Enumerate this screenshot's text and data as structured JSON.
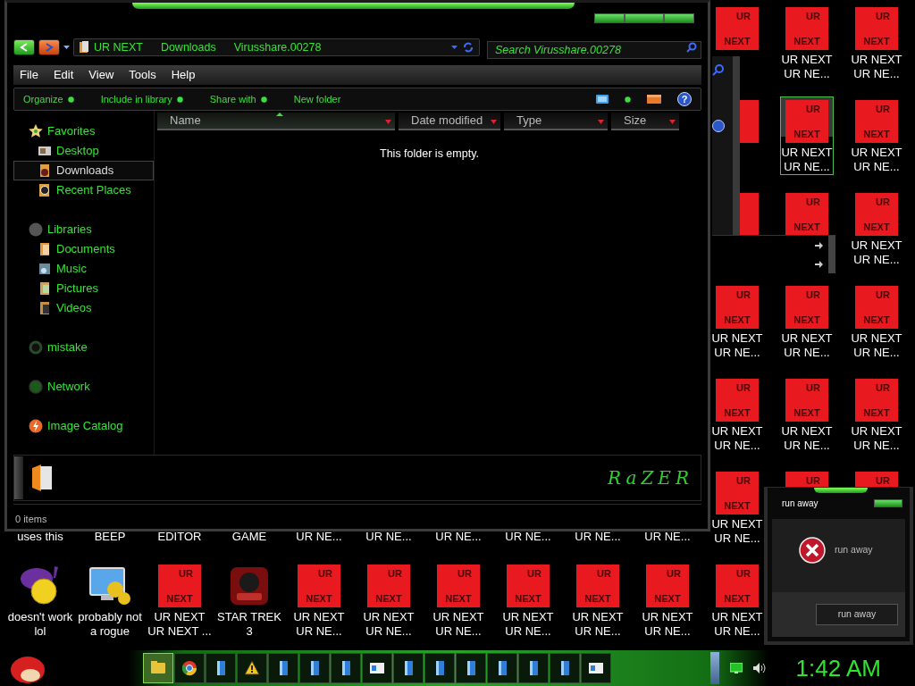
{
  "explorer": {
    "breadcrumb": [
      "UR NEXT",
      "Downloads",
      "Virusshare.00278"
    ],
    "search": {
      "placeholder": "Search Virusshare.00278"
    },
    "menu": [
      "File",
      "Edit",
      "View",
      "Tools",
      "Help"
    ],
    "commands": [
      {
        "label": "Organize",
        "dropdown": true
      },
      {
        "label": "Include in library",
        "dropdown": true
      },
      {
        "label": "Share with",
        "dropdown": true
      },
      {
        "label": "New folder",
        "dropdown": false
      }
    ],
    "help_glyph": "?",
    "sidebar": [
      {
        "label": "Favorites",
        "selected": false,
        "children": [
          {
            "label": "Desktop",
            "selected": false
          },
          {
            "label": "Downloads",
            "selected": true
          },
          {
            "label": "Recent Places",
            "selected": false
          }
        ]
      },
      {
        "label": "Libraries",
        "selected": false,
        "children": [
          {
            "label": "Documents",
            "selected": false
          },
          {
            "label": "Music",
            "selected": false
          },
          {
            "label": "Pictures",
            "selected": false
          },
          {
            "label": "Videos",
            "selected": false
          }
        ]
      },
      {
        "label": "mistake",
        "selected": false
      },
      {
        "label": "Network",
        "selected": false
      },
      {
        "label": "Image Catalog",
        "selected": false
      }
    ],
    "columns": [
      {
        "label": "Name",
        "sorted": true
      },
      {
        "label": "Date modified",
        "sorted": false
      },
      {
        "label": "Type",
        "sorted": false
      },
      {
        "label": "Size",
        "sorted": false
      }
    ],
    "empty_message": "This folder is empty.",
    "logo": "RaZER",
    "status": "0 items"
  },
  "desktop": {
    "right_block": [
      [
        {
          "kind": "app",
          "art_text": [
            "UR",
            "NEXT"
          ],
          "selected": false
        },
        {
          "kind": "app",
          "art_text": [
            "UR",
            "NEXT"
          ],
          "label": "UR NEXT\nUR NE...",
          "selected": false
        },
        {
          "kind": "app",
          "art_text": [
            "UR",
            "NEXT"
          ],
          "label": "UR NEXT\nUR NE...",
          "selected": false
        }
      ],
      [
        {
          "kind": "app",
          "selected": false
        },
        {
          "kind": "app",
          "art_text": [
            "UR",
            "NEXT"
          ],
          "label": "UR NEXT\nUR NE...",
          "selected": true
        },
        {
          "kind": "app",
          "art_text": [
            "UR",
            "NEXT"
          ],
          "label": "UR NEXT\nUR NE...",
          "selected": false
        }
      ],
      [
        {
          "kind": "app",
          "selected": false
        },
        {
          "kind": "app",
          "art_text": [
            "UR",
            "NEXT"
          ],
          "selected": false
        },
        {
          "kind": "app",
          "art_text": [
            "UR",
            "NEXT"
          ],
          "label": "UR NEXT\nUR NE...",
          "selected": false
        }
      ],
      [
        {
          "kind": "app",
          "art_text": [
            "UR",
            "NEXT"
          ],
          "label": "UR NEXT\nUR NE...",
          "selected": false
        },
        {
          "kind": "app",
          "art_text": [
            "UR",
            "NEXT"
          ],
          "label": "UR NEXT\nUR NE...",
          "selected": false
        },
        {
          "kind": "app",
          "art_text": [
            "UR",
            "NEXT"
          ],
          "label": "UR NEXT\nUR NE...",
          "selected": false
        }
      ],
      [
        {
          "kind": "app",
          "art_text": [
            "UR",
            "NEXT"
          ],
          "label": "UR NEXT\nUR NE...",
          "selected": false
        },
        {
          "kind": "app",
          "art_text": [
            "UR",
            "NEXT"
          ],
          "label": "UR NEXT\nUR NE...",
          "selected": false
        },
        {
          "kind": "app",
          "art_text": [
            "UR",
            "NEXT"
          ],
          "label": "UR NEXT\nUR NE...",
          "selected": false
        }
      ]
    ],
    "bottom_rows": [
      [
        {
          "label": "uses this",
          "selected": false
        },
        {
          "label": "BEEP",
          "selected": false
        },
        {
          "label": "EDITOR",
          "selected": false
        },
        {
          "label": "GAME",
          "selected": false
        },
        {
          "label": "UR NE...",
          "selected": false
        },
        {
          "label": "UR NE...",
          "selected": false
        },
        {
          "label": "UR NE...",
          "selected": false
        },
        {
          "label": "UR NE...",
          "selected": false
        },
        {
          "label": "UR NE...",
          "selected": false
        },
        {
          "label": "UR NE...",
          "selected": false
        },
        {
          "kind": "app",
          "art_text": [
            "UR",
            "NEXT"
          ],
          "label": "UR NEXT\nUR NE...",
          "selected": false
        },
        {
          "kind": "app",
          "art_text": [
            "UR"
          ],
          "selected": false
        },
        {
          "kind": "app",
          "art_text": [
            "UR"
          ],
          "selected": false
        }
      ],
      [
        {
          "kind": "messenger",
          "label": "doesn't work\nlol",
          "selected": false
        },
        {
          "kind": "settings",
          "label": "probably not\na rogue",
          "selected": false
        },
        {
          "kind": "app",
          "art_text": [
            "UR",
            "NEXT"
          ],
          "label": "UR NEXT\nUR NEXT ...",
          "selected": false
        },
        {
          "kind": "game",
          "label": "STAR TREK\n3",
          "selected": false
        },
        {
          "kind": "app",
          "art_text": [
            "UR",
            "NEXT"
          ],
          "label": "UR NEXT\nUR NE...",
          "selected": false
        },
        {
          "kind": "app",
          "art_text": [
            "UR",
            "NEXT"
          ],
          "label": "UR NEXT\nUR NE...",
          "selected": false
        },
        {
          "kind": "app",
          "art_text": [
            "UR",
            "NEXT"
          ],
          "label": "UR NEXT\nUR NE...",
          "selected": false
        },
        {
          "kind": "app",
          "art_text": [
            "UR",
            "NEXT"
          ],
          "label": "UR NEXT\nUR NE...",
          "selected": false
        },
        {
          "kind": "app",
          "art_text": [
            "UR",
            "NEXT"
          ],
          "label": "UR NEXT\nUR NE...",
          "selected": false
        },
        {
          "kind": "app",
          "art_text": [
            "UR",
            "NEXT"
          ],
          "label": "UR NEXT\nUR NE...",
          "selected": false
        },
        {
          "kind": "app",
          "art_text": [
            "UR",
            "NEXT"
          ],
          "label": "UR NEXT\nUR NE...",
          "selected": false
        }
      ]
    ]
  },
  "dialog": {
    "title": "run away",
    "message": "run away",
    "button": "run away"
  },
  "taskbar": {
    "buttons": [
      {
        "kind": "folder",
        "selected": true
      },
      {
        "kind": "browser",
        "selected": false
      },
      {
        "kind": "document",
        "selected": false
      },
      {
        "kind": "warning",
        "selected": false
      },
      {
        "kind": "document",
        "selected": false
      },
      {
        "kind": "document",
        "selected": false
      },
      {
        "kind": "document",
        "selected": false
      },
      {
        "kind": "window",
        "selected": false
      },
      {
        "kind": "document",
        "selected": false
      },
      {
        "kind": "document",
        "selected": false
      },
      {
        "kind": "document",
        "selected": false
      },
      {
        "kind": "document",
        "selected": false
      },
      {
        "kind": "document",
        "selected": false
      },
      {
        "kind": "document",
        "selected": false
      },
      {
        "kind": "window",
        "selected": false
      }
    ],
    "clock": "1:42 AM"
  }
}
